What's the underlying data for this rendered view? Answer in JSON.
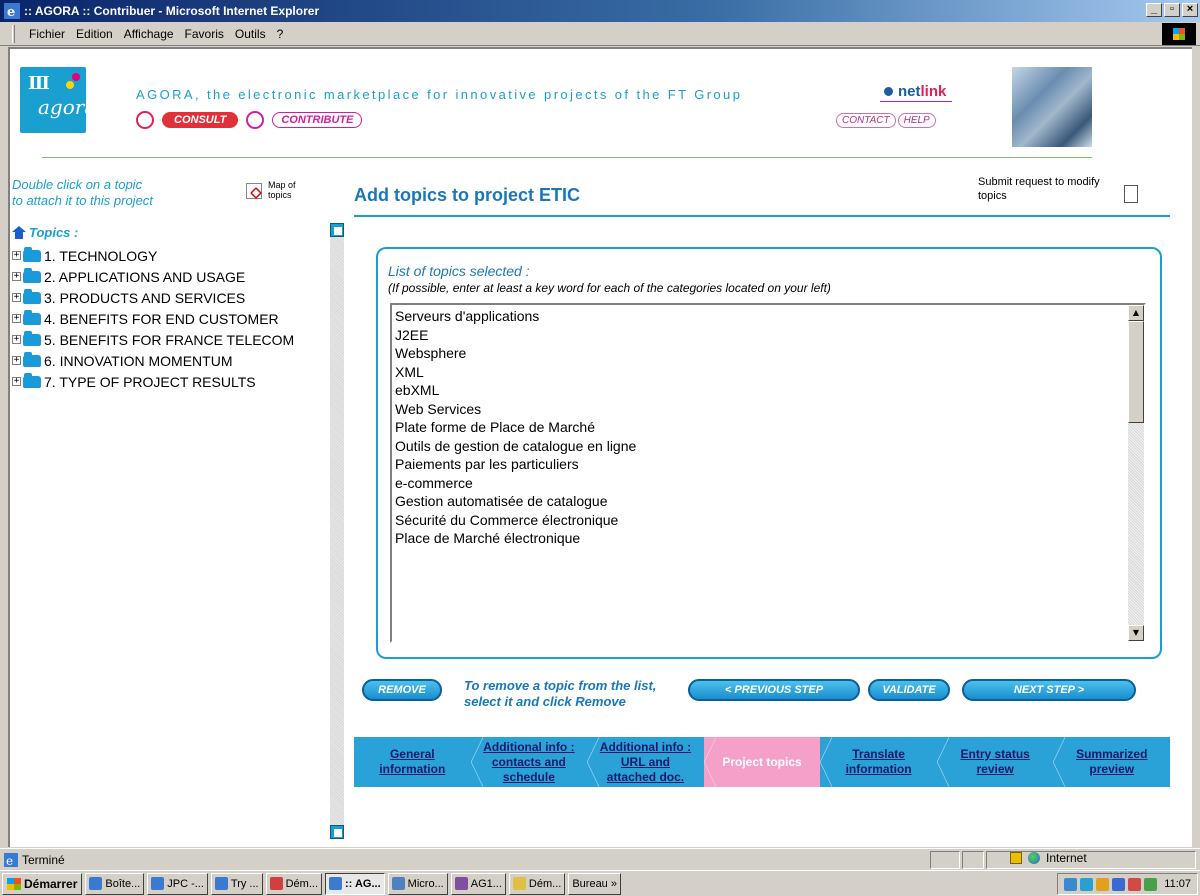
{
  "window": {
    "title": ":: AGORA :: Contribuer - Microsoft Internet Explorer",
    "controls": [
      "_",
      "▫",
      "×"
    ]
  },
  "menu": [
    "Fichier",
    "Edition",
    "Affichage",
    "Favoris",
    "Outils",
    "?"
  ],
  "header": {
    "logo_text": "agora",
    "tagline": "AGORA, the electronic marketplace for innovative projects of the FT Group",
    "consult": "CONSULT",
    "contribute": "CONTRIBUTE",
    "netlink_a": "net",
    "netlink_b": "link",
    "contact": "CONTACT",
    "help": "HELP"
  },
  "left": {
    "hint_line1": "Double click on a topic",
    "hint_line2": "to attach it to this project",
    "map_line1": "Map of",
    "map_line2": "topics",
    "topics_label": "Topics :",
    "tree": [
      "1. TECHNOLOGY",
      "2. APPLICATIONS AND USAGE",
      "3. PRODUCTS AND SERVICES",
      "4. BENEFITS FOR END CUSTOMER",
      "5. BENEFITS FOR FRANCE TELECOM",
      "6. INNOVATION MOMENTUM",
      "7. TYPE OF PROJECT RESULTS"
    ]
  },
  "main": {
    "title": "Add topics to project ETIC",
    "submit_request_line1": "Submit request to modify",
    "submit_request_line2": "topics",
    "list_title": "List of topics selected :",
    "list_subtitle": "(If possible, enter at least a key word for each of the categories located on your left)",
    "selected_topics": [
      "Serveurs d'applications",
      "J2EE",
      "Websphere",
      "XML",
      "ebXML",
      "Web Services",
      "Plate forme de Place de Marché",
      "Outils de gestion de catalogue en ligne",
      "Paiements par les particuliers",
      "e-commerce",
      "Gestion automatisée de catalogue",
      "Sécurité du Commerce électronique",
      "Place de Marché électronique"
    ],
    "remove_button": "REMOVE",
    "remove_hint": "To remove a topic from the list, select it and click Remove",
    "previous_button": "< PREVIOUS STEP",
    "validate_button": "VALIDATE",
    "next_button": "NEXT STEP >"
  },
  "steps": [
    {
      "label": "General information",
      "active": false
    },
    {
      "label": "Additional info : contacts and schedule",
      "active": false
    },
    {
      "label": "Additional info : URL and attached doc.",
      "active": false
    },
    {
      "label": "Project topics",
      "active": true
    },
    {
      "label": "Translate information",
      "active": false
    },
    {
      "label": "Entry status review",
      "active": false
    },
    {
      "label": "Summarized preview",
      "active": false
    }
  ],
  "status": {
    "text": "Terminé",
    "zone": "Internet"
  },
  "taskbar": {
    "start": "Démarrer",
    "tasks": [
      "Boîte...",
      "JPC -...",
      "Try ...",
      "Dém...",
      ":: AG...",
      "Micro...",
      "AG1...",
      "Dém..."
    ],
    "active_task": ":: AG...",
    "bureau": "Bureau",
    "clock": "11:07"
  },
  "colors": {
    "accent": "#1aa0d0",
    "title_blue": "#1a78b8",
    "active_step": "#f5a0c8",
    "step_bg": "#2aa2d8"
  }
}
